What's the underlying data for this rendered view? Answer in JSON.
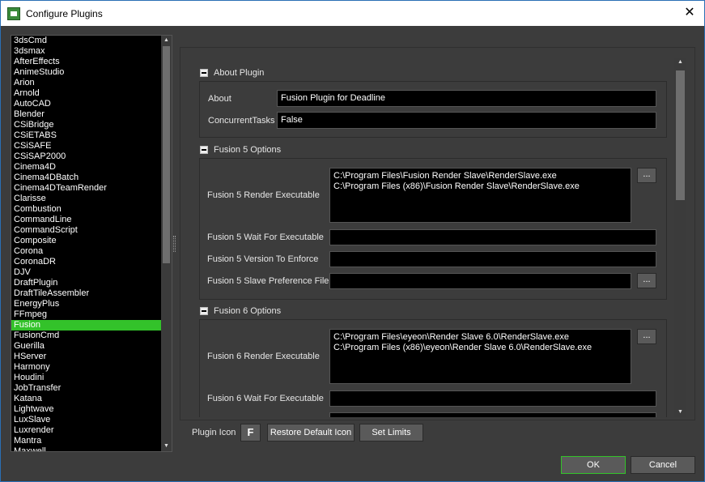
{
  "window": {
    "title": "Configure Plugins"
  },
  "plugin_list": [
    "3dsCmd",
    "3dsmax",
    "AfterEffects",
    "AnimeStudio",
    "Arion",
    "Arnold",
    "AutoCAD",
    "Blender",
    "CSiBridge",
    "CSiETABS",
    "CSiSAFE",
    "CSiSAP2000",
    "Cinema4D",
    "Cinema4DBatch",
    "Cinema4DTeamRender",
    "Clarisse",
    "Combustion",
    "CommandLine",
    "CommandScript",
    "Composite",
    "Corona",
    "CoronaDR",
    "DJV",
    "DraftPlugin",
    "DraftTileAssembler",
    "EnergyPlus",
    "FFmpeg",
    "Fusion",
    "FusionCmd",
    "Guerilla",
    "HServer",
    "Harmony",
    "Houdini",
    "JobTransfer",
    "Katana",
    "Lightwave",
    "LuxSlave",
    "Luxrender",
    "Mantra",
    "Maxwell"
  ],
  "selected_plugin": "Fusion",
  "sections": {
    "about": {
      "header": "About Plugin",
      "about_label": "About",
      "about_value": "Fusion Plugin for Deadline",
      "concurrent_label": "ConcurrentTasks",
      "concurrent_value": "False"
    },
    "fusion5": {
      "header": "Fusion 5 Options",
      "render_exec_label": "Fusion 5 Render Executable",
      "render_exec_value": "C:\\Program Files\\Fusion Render Slave\\RenderSlave.exe\nC:\\Program Files (x86)\\Fusion Render Slave\\RenderSlave.exe",
      "wait_label": "Fusion 5 Wait For Executable",
      "wait_value": "",
      "version_label": "Fusion 5 Version To Enforce",
      "version_value": "",
      "slave_pref_label": "Fusion 5 Slave Preference File",
      "slave_pref_value": "",
      "browse": "..."
    },
    "fusion6": {
      "header": "Fusion 6 Options",
      "render_exec_label": "Fusion 6 Render Executable",
      "render_exec_value": "C:\\Program Files\\eyeon\\Render Slave 6.0\\RenderSlave.exe\nC:\\Program Files (x86)\\eyeon\\Render Slave 6.0\\RenderSlave.exe",
      "wait_label": "Fusion 6 Wait For Executable",
      "wait_value": "",
      "browse": "..."
    }
  },
  "bottom": {
    "plugin_icon_label": "Plugin Icon",
    "plugin_icon_glyph": "F",
    "restore_label": "Restore Default Icon",
    "set_limits_label": "Set Limits",
    "ok_label": "OK",
    "cancel_label": "Cancel"
  }
}
